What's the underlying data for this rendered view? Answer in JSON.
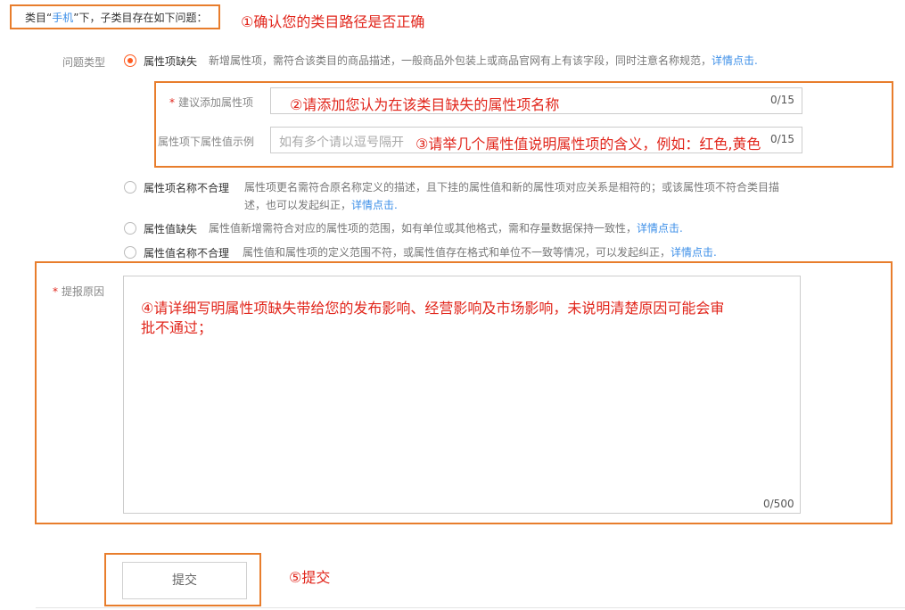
{
  "category_bar": {
    "prefix": "类目“",
    "category": "手机",
    "suffix": "”下，子类目存在如下问题："
  },
  "issue_type_label": "问题类型",
  "options": [
    {
      "name": "属性项缺失",
      "checked": true,
      "desc": "新增属性项，需符合该类目的商品描述，一般商品外包装上或商品官网有上有该字段，同时注意名称规范，",
      "link": "详情点击."
    },
    {
      "name": "属性项名称不合理",
      "checked": false,
      "desc_line1": "属性项更名需符合原名称定义的描述，且下挂的属性值和新的属性项对应关系是相符的；或该属性项不符合类目描",
      "desc_line2": "述，也可以发起纠正，",
      "link": "详情点击."
    },
    {
      "name": "属性值缺失",
      "checked": false,
      "desc": "属性值新增需符合对应的属性项的范围，如有单位或其他格式，需和存量数据保持一致性，",
      "link": "详情点击."
    },
    {
      "name": "属性值名称不合理",
      "checked": false,
      "desc": "属性值和属性项的定义范围不符，或属性值存在格式和单位不一致等情况，可以发起纠正，",
      "link": "详情点击."
    }
  ],
  "fields": {
    "suggest_attr": {
      "required_mark": "*",
      "label": "建议添加属性项",
      "value": "",
      "counter": "0/15"
    },
    "attr_value_example": {
      "label": "属性项下属性值示例",
      "placeholder": "如有多个请以逗号隔开",
      "counter": "0/15"
    },
    "reason": {
      "required_mark": "*",
      "label": "提报原因",
      "value": "",
      "counter": "0/500"
    }
  },
  "submit_label": "提交",
  "annotations": {
    "a1": "①确认您的类目路径是否正确",
    "a2": "②请添加您认为在该类目缺失的属性项名称",
    "a3": "③请举几个属性值说明属性项的含义，例如：红色,黄色",
    "a4_line1": "④请详细写明属性项缺失带给您的发布影响、经营影响及市场影响，未说明清楚原因可能会审",
    "a4_line2": "批不通过；",
    "a5": "⑤提交"
  },
  "colors": {
    "accent_orange": "#e87d2c",
    "annotation_red": "#e1251b",
    "link_blue": "#3d8fe8",
    "radio_checked": "#ff5a1f"
  }
}
